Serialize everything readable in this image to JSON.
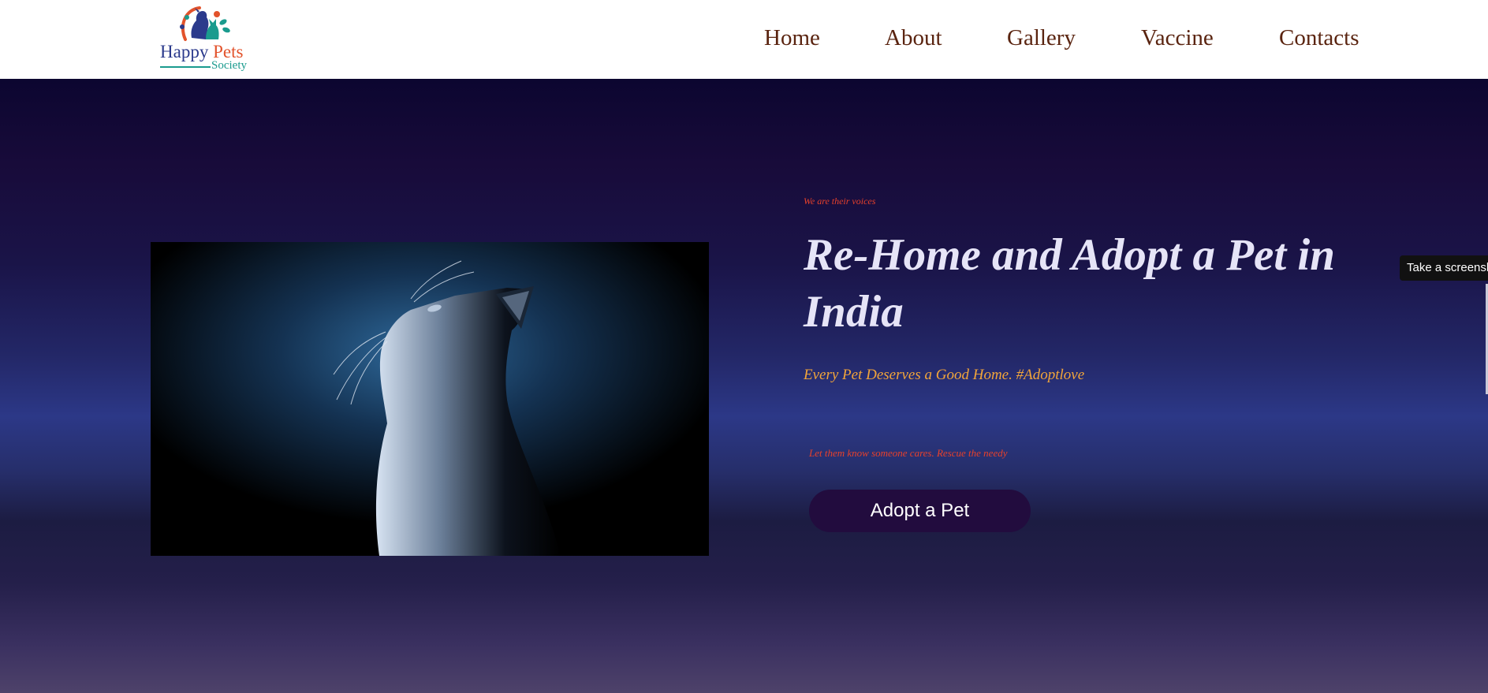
{
  "brand": {
    "name_part1": "Happy",
    "name_part2": "Pets",
    "name_part3": "Society",
    "colors": {
      "blue": "#2b3a8c",
      "orange": "#e2532c",
      "teal": "#1a9b8e"
    }
  },
  "nav": {
    "items": [
      {
        "label": "Home"
      },
      {
        "label": "About"
      },
      {
        "label": "Gallery"
      },
      {
        "label": "Vaccine"
      },
      {
        "label": "Contacts"
      }
    ]
  },
  "hero": {
    "tagline": "We are their voices",
    "headline": "Re-Home and Adopt a Pet in India",
    "subhead": "Every Pet Deserves a Good Home. #Adoptlove",
    "small_line": "Let them know someone cares. Rescue the needy",
    "cta_label": "Adopt a Pet",
    "image_icon": "cat-photo",
    "colors": {
      "cta_bg": "#220c3e",
      "headline": "#e6e4f7",
      "subhead": "#f2a53a",
      "accent": "#e8412b"
    }
  },
  "overlay": {
    "screenshot_label": "Take a screenshot"
  }
}
